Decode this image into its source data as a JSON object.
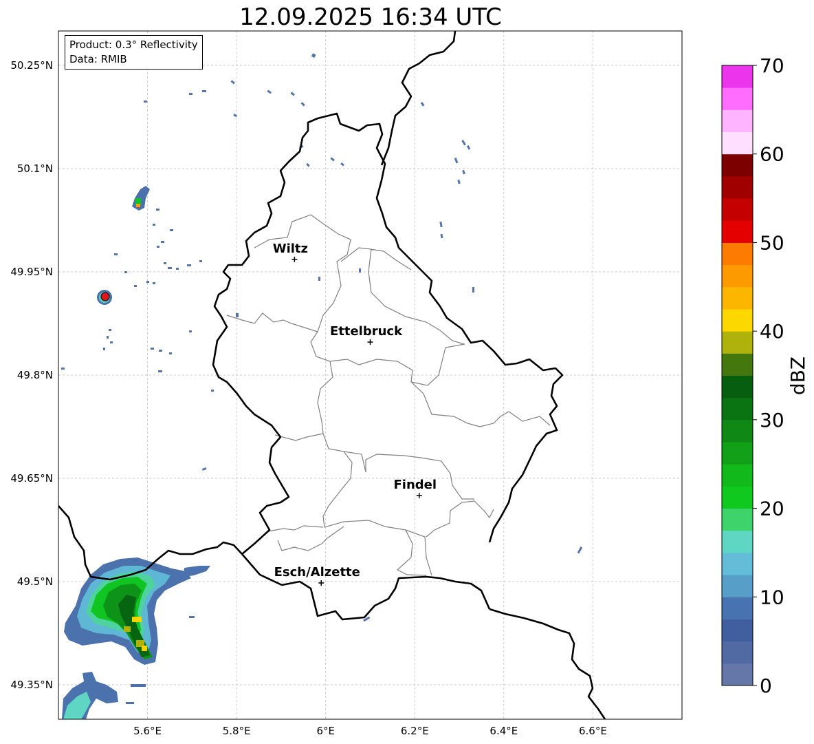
{
  "title": "12.09.2025 16:34 UTC",
  "info": {
    "product": "Product: 0.3° Reflectivity",
    "data": "Data: RMIB"
  },
  "map": {
    "lon_range": [
      5.4,
      6.8
    ],
    "lat_range": [
      49.3,
      50.3
    ],
    "lat_ticks": [
      {
        "value": 50.25,
        "label": "50.25°N"
      },
      {
        "value": 50.1,
        "label": "50.1°N"
      },
      {
        "value": 49.95,
        "label": "49.95°N"
      },
      {
        "value": 49.8,
        "label": "49.8°N"
      },
      {
        "value": 49.65,
        "label": "49.65°N"
      },
      {
        "value": 49.5,
        "label": "49.5°N"
      },
      {
        "value": 49.35,
        "label": "49.35°N"
      }
    ],
    "lon_ticks": [
      {
        "value": 5.6,
        "label": "5.6°E"
      },
      {
        "value": 5.8,
        "label": "5.8°E"
      },
      {
        "value": 6.0,
        "label": "6°E"
      },
      {
        "value": 6.2,
        "label": "6.2°E"
      },
      {
        "value": 6.4,
        "label": "6.4°E"
      },
      {
        "value": 6.6,
        "label": "6.6°E"
      }
    ],
    "grid_lons": [
      5.6,
      5.8,
      6.0,
      6.2,
      6.4,
      6.6
    ],
    "grid_lats": [
      50.25,
      50.1,
      49.95,
      49.8,
      49.65,
      49.5,
      49.35
    ],
    "cities": [
      {
        "name": "Wiltz",
        "lon": 5.93,
        "lat": 49.968
      },
      {
        "name": "Ettelbruck",
        "lon": 6.1,
        "lat": 49.848
      },
      {
        "name": "Findel",
        "lon": 6.21,
        "lat": 49.625
      },
      {
        "name": "Esch/Alzette",
        "lon": 5.99,
        "lat": 49.498
      }
    ],
    "radar_site": {
      "lon": 5.505,
      "lat": 49.914,
      "color": "#e0141e"
    }
  },
  "colorbar": {
    "label": "dBZ",
    "min": 0,
    "max": 70,
    "ticks": [
      {
        "value": 0,
        "label": "0"
      },
      {
        "value": 10,
        "label": "10"
      },
      {
        "value": 20,
        "label": "20"
      },
      {
        "value": 30,
        "label": "30"
      },
      {
        "value": 40,
        "label": "40"
      },
      {
        "value": 50,
        "label": "50"
      },
      {
        "value": 60,
        "label": "60"
      },
      {
        "value": 70,
        "label": "70"
      }
    ],
    "colors": [
      "#6577a8",
      "#526aa4",
      "#415f9f",
      "#4774b0",
      "#579fc8",
      "#63bcd8",
      "#5fd6c4",
      "#3fd36c",
      "#10c91e",
      "#12b91a",
      "#11a017",
      "#0f8816",
      "#0a7412",
      "#075e0e",
      "#44770d",
      "#afb20a",
      "#fdd800",
      "#fdb600",
      "#fd9a00",
      "#fd7c00",
      "#e40000",
      "#c40000",
      "#a10000",
      "#7d0000",
      "#ffdfff",
      "#ffb4ff",
      "#ff6dff",
      "#eb34eb"
    ]
  }
}
